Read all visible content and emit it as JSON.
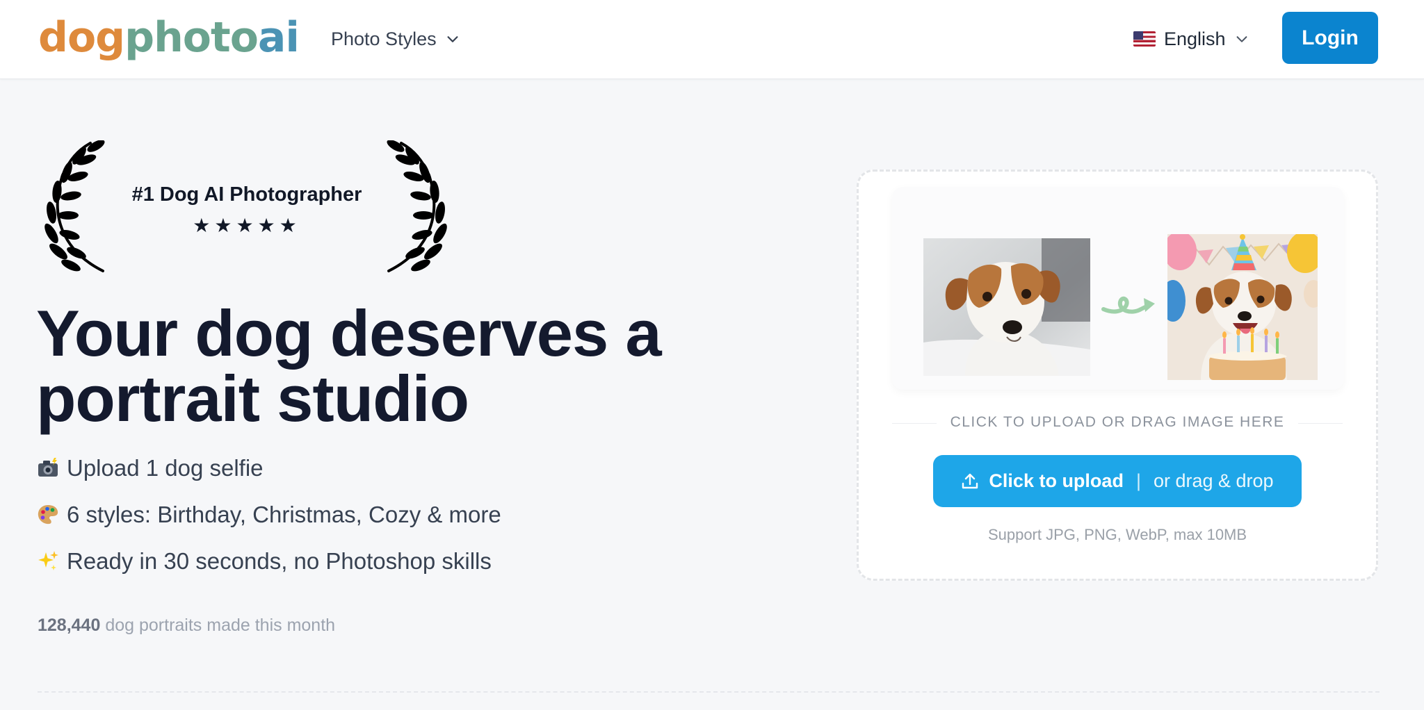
{
  "header": {
    "logo": {
      "part1": "dog",
      "part2": "photo",
      "part3": "ai"
    },
    "nav_styles_label": "Photo Styles",
    "language_label": "English",
    "login_label": "Login"
  },
  "hero": {
    "award_title": "#1 Dog AI Photographer",
    "award_stars": "★★★★★",
    "title_line1": "Your dog deserves a",
    "title_line2": "portrait studio",
    "features": [
      {
        "icon": "camera-flash-icon",
        "text": "Upload 1 dog selfie"
      },
      {
        "icon": "palette-icon",
        "text": "6 styles: Birthday, Christmas, Cozy & more"
      },
      {
        "icon": "sparkles-icon",
        "text": "Ready in 30 seconds, no Photoshop skills"
      }
    ],
    "stat_count": "128,440",
    "stat_text": "dog portraits made this month"
  },
  "upload": {
    "instruction": "CLICK TO UPLOAD OR DRAG IMAGE HERE",
    "button_main": "Click to upload",
    "button_sep": "|",
    "button_alt": "or drag & drop",
    "support": "Support JPG, PNG, WebP, max 10MB"
  },
  "colors": {
    "accent": "#1ea6e8",
    "login": "#0b84cf",
    "title": "#141a2e",
    "logo_orange": "#de8a3c",
    "logo_teal": "#6aa38f",
    "logo_blue": "#4b93b4"
  }
}
